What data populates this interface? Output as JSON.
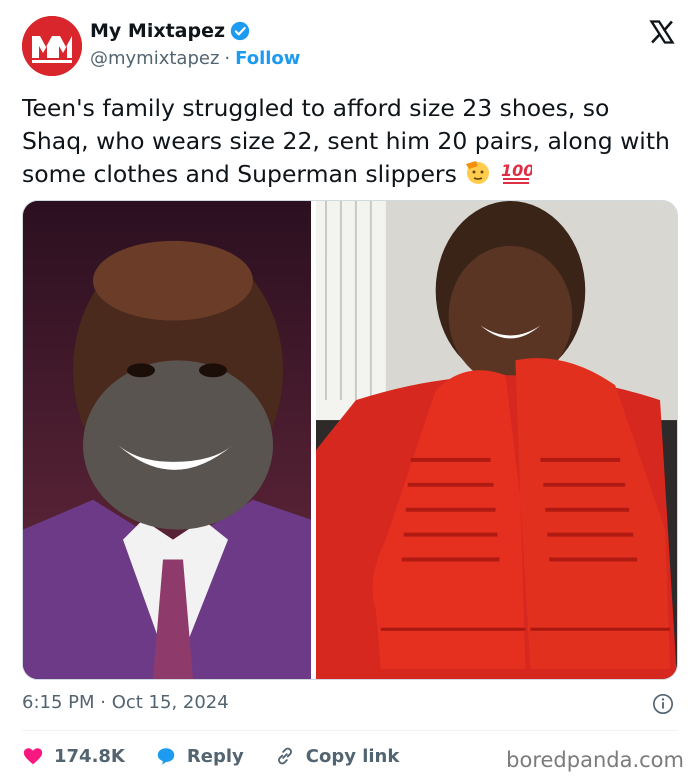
{
  "account": {
    "avatar_text": "MM",
    "name": "My Mixtapez",
    "handle": "@mymixtapez",
    "separator": "·",
    "follow_label": "Follow"
  },
  "tweet": {
    "text": "Teen's family struggled to afford size 23 shoes, so Shaq, who wears size 22, sent him 20 pairs, along with some clothes and Superman slippers",
    "emojis": [
      "saluting-face",
      "hundred-points"
    ],
    "timestamp": "6:15 PM · Oct 15, 2024"
  },
  "media": {
    "left_photo": "portrait of smiling bearded man in purple suit",
    "right_photo": "teen holding up a pair of large red sneakers"
  },
  "actions": {
    "likes": "174.8K",
    "reply_label": "Reply",
    "copy_label": "Copy link"
  },
  "watermark": "boredpanda.com",
  "colors": {
    "accent": "#1d9bf0",
    "heart": "#f91880",
    "avatar": "#d9262c",
    "secondary_text": "#536471"
  }
}
